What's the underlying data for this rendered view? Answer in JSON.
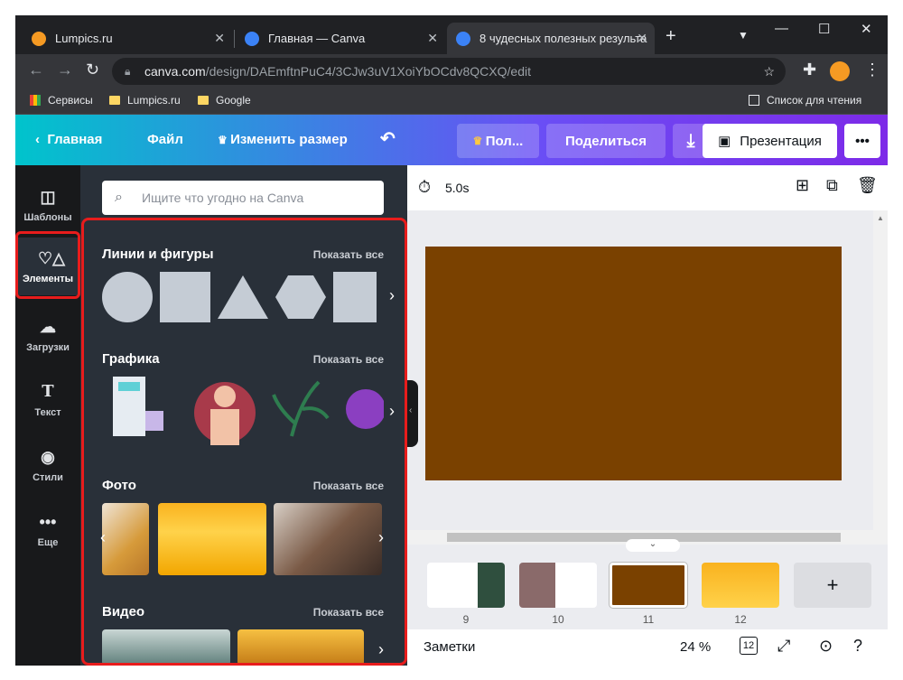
{
  "browser": {
    "tabs": [
      {
        "title": "Lumpics.ru",
        "icon": "lumpics-orange-icon"
      },
      {
        "title": "Главная — Canva",
        "icon": "canva-icon"
      },
      {
        "title": "8 чудесных полезных результа",
        "icon": "canva-icon"
      }
    ],
    "new_tab": "+",
    "url_host": "canva.com",
    "url_path": "/design/DAEmftnPuC4/3CJw3uV1XoiYbOCdv8QCXQ/edit",
    "bookmarks": [
      "Сервисы",
      "Lumpics.ru",
      "Google"
    ],
    "reading_list": "Список для чтения"
  },
  "header": {
    "home": "Главная",
    "file": "Файл",
    "resize": "Изменить размер",
    "pro": "Пол...",
    "share": "Поделиться",
    "present": "Презентация",
    "more": "•••"
  },
  "rail": [
    {
      "label": "Шаблоны",
      "icon": "templates-icon"
    },
    {
      "label": "Элементы",
      "icon": "elements-icon"
    },
    {
      "label": "Загрузки",
      "icon": "upload-icon"
    },
    {
      "label": "Текст",
      "icon": "text-icon"
    },
    {
      "label": "Стили",
      "icon": "palette-icon"
    },
    {
      "label": "Еще",
      "icon": "more-icon"
    }
  ],
  "panel": {
    "search_placeholder": "Ищите что угодно на Canva",
    "sections": [
      {
        "title": "Линии и фигуры",
        "show_all": "Показать все"
      },
      {
        "title": "Графика",
        "show_all": "Показать все"
      },
      {
        "title": "Фото",
        "show_all": "Показать все"
      },
      {
        "title": "Видео",
        "show_all": "Показать все"
      }
    ]
  },
  "canvas": {
    "duration": "5.0s",
    "page_color": "#7a4100"
  },
  "filmstrip": {
    "slides": [
      "9",
      "10",
      "11",
      "12"
    ],
    "add": "+"
  },
  "footer": {
    "notes": "Заметки",
    "zoom": "24 %",
    "page_count": "12"
  }
}
